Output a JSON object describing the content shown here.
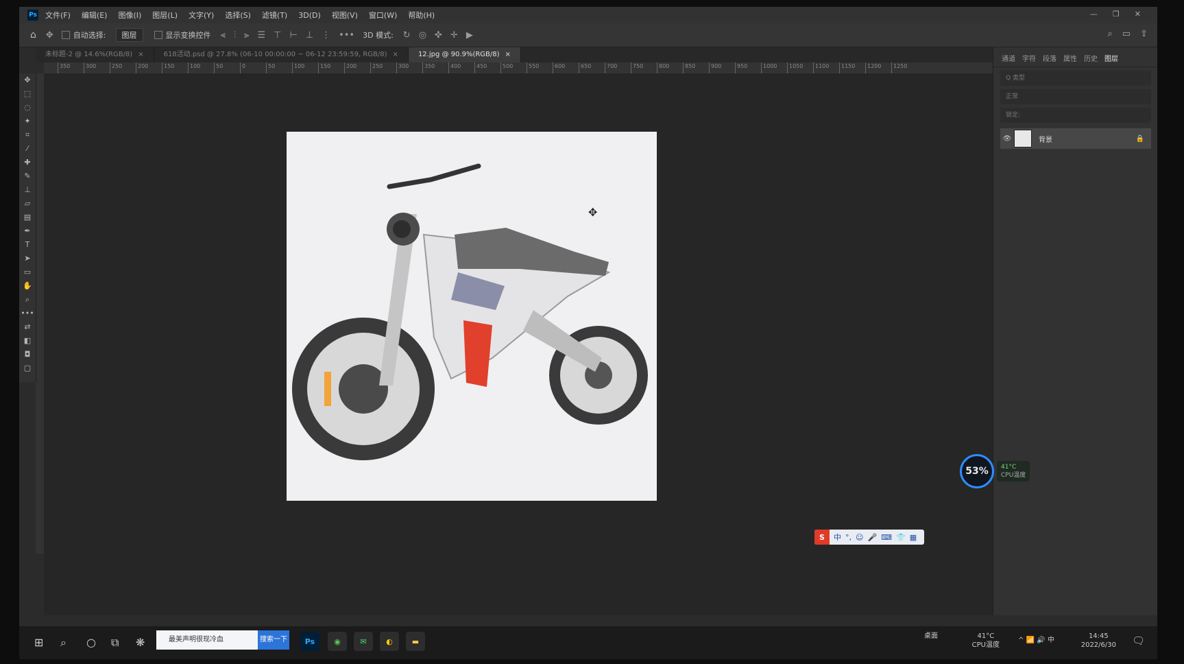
{
  "menu": [
    "文件(F)",
    "编辑(E)",
    "图像(I)",
    "图层(L)",
    "文字(Y)",
    "选择(S)",
    "滤镜(T)",
    "3D(D)",
    "视图(V)",
    "窗口(W)",
    "帮助(H)"
  ],
  "options": {
    "auto_select_label": "自动选择:",
    "auto_select_value": "图层",
    "show_transform_label": "显示变换控件",
    "mode_3d_label": "3D 模式:"
  },
  "tabs": [
    {
      "label": "未标题-2 @ 14.6%(RGB/8)",
      "close": "×"
    },
    {
      "label": "618活动.psd @ 27.8% (06-10 00:00:00 ~ 06-12 23:59:59, RGB/8)",
      "close": "×"
    },
    {
      "label": "12.jpg @ 90.9%(RGB/8)",
      "close": "×"
    }
  ],
  "ruler_ticks": [
    "350",
    "300",
    "250",
    "200",
    "150",
    "100",
    "50",
    "0",
    "50",
    "100",
    "150",
    "200",
    "250",
    "300",
    "350",
    "400",
    "450",
    "500",
    "550",
    "600",
    "650",
    "700",
    "750",
    "800",
    "850",
    "900",
    "950",
    "1000",
    "1050",
    "1100",
    "1150",
    "1200",
    "1250"
  ],
  "panel_tabs": [
    "通道",
    "字符",
    "段落",
    "属性",
    "历史",
    "图层"
  ],
  "panel_rows": [
    "Q 类型",
    "正常",
    "锁定:"
  ],
  "layer": {
    "name": "背景",
    "lock": "🔒"
  },
  "cpu": {
    "percent": "53%",
    "temp": "41°C",
    "label": "CPU温度"
  },
  "ime": {
    "logo": "S",
    "items": [
      "中",
      "°,",
      "☺",
      "🎤",
      "⌨",
      "👕",
      "▦"
    ]
  },
  "taskbar": {
    "search_placeholder": "最美声明很现冷血",
    "search_button": "搜索一下",
    "ps_label": "Ps",
    "tray_label": "桌面",
    "temp": "41°C",
    "temp_label": "CPU温度",
    "ime_indicator": "中",
    "time": "14:45",
    "date": "2022/6/30"
  },
  "colors": {
    "accent": "#2f8cff",
    "ps_blue": "#31a8ff",
    "battery_red": "#e0402c",
    "canvas_bg": "#f0f0f2"
  }
}
